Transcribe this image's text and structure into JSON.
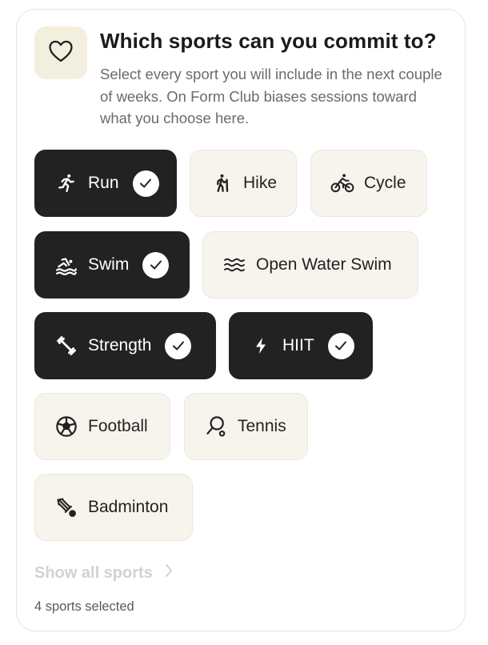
{
  "header": {
    "icon": "heart-icon",
    "title": "Which sports can you commit to?",
    "subtitle": "Select every sport you will include in the next couple of weeks. On Form Club biases sessions toward what you choose here."
  },
  "sports": [
    {
      "label": "Run",
      "icon": "running-person-icon",
      "selected": true
    },
    {
      "label": "Hike",
      "icon": "hiking-person-icon",
      "selected": false
    },
    {
      "label": "Cycle",
      "icon": "cyclist-icon",
      "selected": false
    },
    {
      "label": "Swim",
      "icon": "swimmer-icon",
      "selected": true
    },
    {
      "label": "Open Water Swim",
      "icon": "waves-icon",
      "selected": false
    },
    {
      "label": "Strength",
      "icon": "dumbbell-icon",
      "selected": true
    },
    {
      "label": "HIIT",
      "icon": "lightning-icon",
      "selected": true
    },
    {
      "label": "Football",
      "icon": "football-icon",
      "selected": false
    },
    {
      "label": "Tennis",
      "icon": "tennis-racket-icon",
      "selected": false
    },
    {
      "label": "Badminton",
      "icon": "shuttlecock-icon",
      "selected": false
    }
  ],
  "footer": {
    "show_all_label": "Show all sports",
    "selected_count": "4 sports selected"
  },
  "colors": {
    "selected_bg": "#222222",
    "unselected_bg": "#f7f4ed",
    "icon_box_bg": "#f3efdf",
    "muted_link": "#d4d2cd"
  }
}
